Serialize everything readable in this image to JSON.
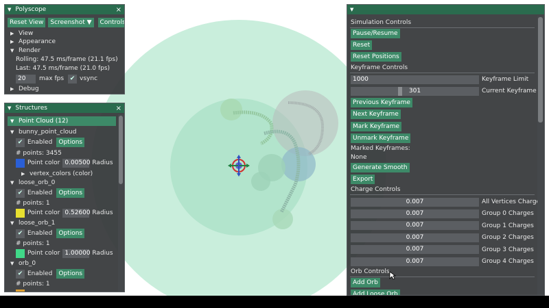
{
  "polyscope": {
    "title": "Polyscope",
    "reset_view": "Reset View",
    "screenshot": "Screenshot",
    "controls": "Controls",
    "view": "View",
    "appearance": "Appearance",
    "render": "Render",
    "rolling": "Rolling: 47.5 ms/frame (21.1 fps)",
    "last": "Last: 47.5 ms/frame (21.0 fps)",
    "max_fps_value": "20",
    "max_fps_label": "max fps",
    "vsync": "vsync",
    "debug": "Debug"
  },
  "structures": {
    "title": "Structures",
    "group": "Point Cloud (12)",
    "enabled_label": "Enabled",
    "options_label": "Options",
    "point_color_label": "Point color",
    "radius_label": "Radius",
    "items": [
      {
        "name": "bunny_point_cloud",
        "points": "# points: 3455",
        "color": "#2a5fd6",
        "radius": "0.00500",
        "sub": "vertex_colors (color)"
      },
      {
        "name": "loose_orb_0",
        "points": "# points: 1",
        "color": "#e8e030",
        "radius": "0.52600"
      },
      {
        "name": "loose_orb_1",
        "points": "# points: 1",
        "color": "#40d888",
        "radius": "1.00000"
      },
      {
        "name": "orb_0",
        "points": "# points: 1",
        "color": "#e0a030",
        "radius": ""
      }
    ]
  },
  "sim": {
    "simulation_controls": "Simulation Controls",
    "pause_resume": "Pause/Resume",
    "reset": "Reset",
    "reset_positions": "Reset Positions",
    "keyframe_controls": "Keyframe Controls",
    "keyframe_limit_value": "1000",
    "keyframe_limit_label": "Keyframe Limit",
    "current_keyframe_value": "301",
    "current_keyframe_label": "Current Keyframe",
    "current_keyframe_fraction": 0.301,
    "previous_keyframe": "Previous Keyframe",
    "next_keyframe": "Next Keyframe",
    "mark_keyframe": "Mark Keyframe",
    "unmark_keyframe": "Unmark Keyframe",
    "marked_keyframes": "Marked Keyframes:",
    "marked_none": "None",
    "generate_smooth": "Generate Smooth",
    "export": "Export",
    "charge_controls": "Charge Controls",
    "charges": [
      {
        "value": "0.007",
        "label": "All Vertices Charges"
      },
      {
        "value": "0.007",
        "label": "Group 0 Charges"
      },
      {
        "value": "0.007",
        "label": "Group 1 Charges"
      },
      {
        "value": "0.007",
        "label": "Group 2 Charges"
      },
      {
        "value": "0.007",
        "label": "Group 3 Charges"
      },
      {
        "value": "0.007",
        "label": "Group 4 Charges"
      }
    ],
    "orb_controls": "Orb Controls",
    "add_orb": "Add Orb",
    "add_loose_orb": "Add Loose Orb"
  }
}
